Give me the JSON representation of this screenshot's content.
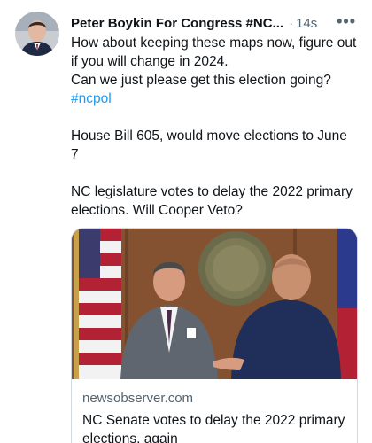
{
  "tweet": {
    "author_name": "Peter Boykin For Congress #NC...",
    "separator": "·",
    "time": "14s",
    "more_label": "•••",
    "text": {
      "line1": "How about keeping these maps now, figure out",
      "line2": "if you will change in 2024.",
      "line3": "Can we just please get this election going?",
      "hashtag": "#ncpol",
      "line5": "House Bill 605,  would move elections to June",
      "line6": "7",
      "line7": "NC legislature votes to delay the 2022 primary",
      "line8": "elections. Will Cooper Veto?"
    },
    "card": {
      "domain": "newsobserver.com",
      "title_line1": "NC Senate votes to delay the 2022 primary",
      "title_line2": "elections, again"
    },
    "colors": {
      "link": "#1d9bf0",
      "secondary": "#536471",
      "text": "#0f1419",
      "border": "#cfd9de"
    }
  }
}
